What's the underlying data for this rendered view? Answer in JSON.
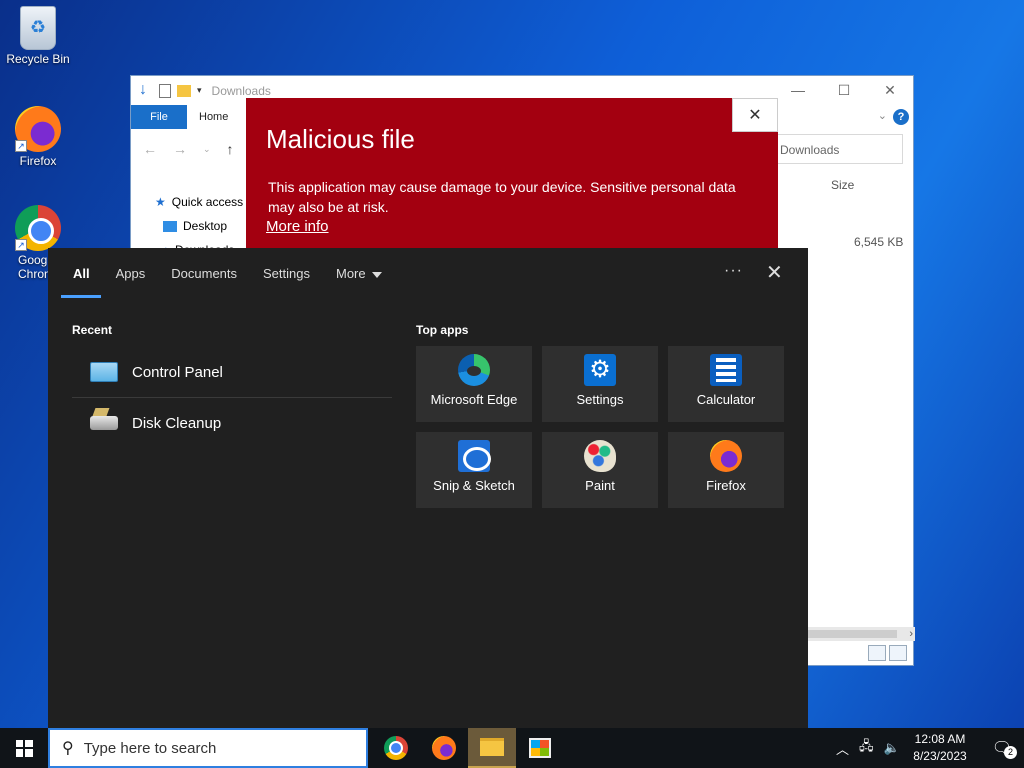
{
  "desktop": {
    "icons": [
      {
        "label": "Recycle Bin"
      },
      {
        "label": "Firefox"
      },
      {
        "label": "Goog\nChron"
      }
    ]
  },
  "explorer": {
    "title": "Downloads",
    "ribbon": {
      "file": "File",
      "home": "Home"
    },
    "search_placeholder": "Downloads",
    "column_size": "Size",
    "file_size": "6,545 KB",
    "tree": [
      "Quick access",
      "Desktop",
      "Downloads"
    ]
  },
  "malicious": {
    "title": "Malicious file",
    "body": "This application may cause damage to your device. Sensitive personal data may also be at risk.",
    "link": "More info",
    "close": "✕"
  },
  "search_panel": {
    "tabs": [
      {
        "label": "All",
        "active": true
      },
      {
        "label": "Apps"
      },
      {
        "label": "Documents"
      },
      {
        "label": "Settings"
      },
      {
        "label": "More"
      }
    ],
    "more_menu": "···",
    "close": "✕",
    "recent_heading": "Recent",
    "recent": [
      {
        "label": "Control Panel",
        "icon": "control-panel-icon"
      },
      {
        "label": "Disk Cleanup",
        "icon": "disk-cleanup-icon"
      }
    ],
    "top_apps_heading": "Top apps",
    "top_apps": [
      {
        "label": "Microsoft Edge",
        "icon": "edge-icon"
      },
      {
        "label": "Settings",
        "icon": "settings-icon"
      },
      {
        "label": "Calculator",
        "icon": "calculator-icon"
      },
      {
        "label": "Snip & Sketch",
        "icon": "snip-sketch-icon"
      },
      {
        "label": "Paint",
        "icon": "paint-icon"
      },
      {
        "label": "Firefox",
        "icon": "firefox-icon"
      }
    ]
  },
  "taskbar": {
    "search_placeholder": "Type here to search",
    "clock_time": "12:08 AM",
    "clock_date": "8/23/2023",
    "notifications_count": "2"
  }
}
